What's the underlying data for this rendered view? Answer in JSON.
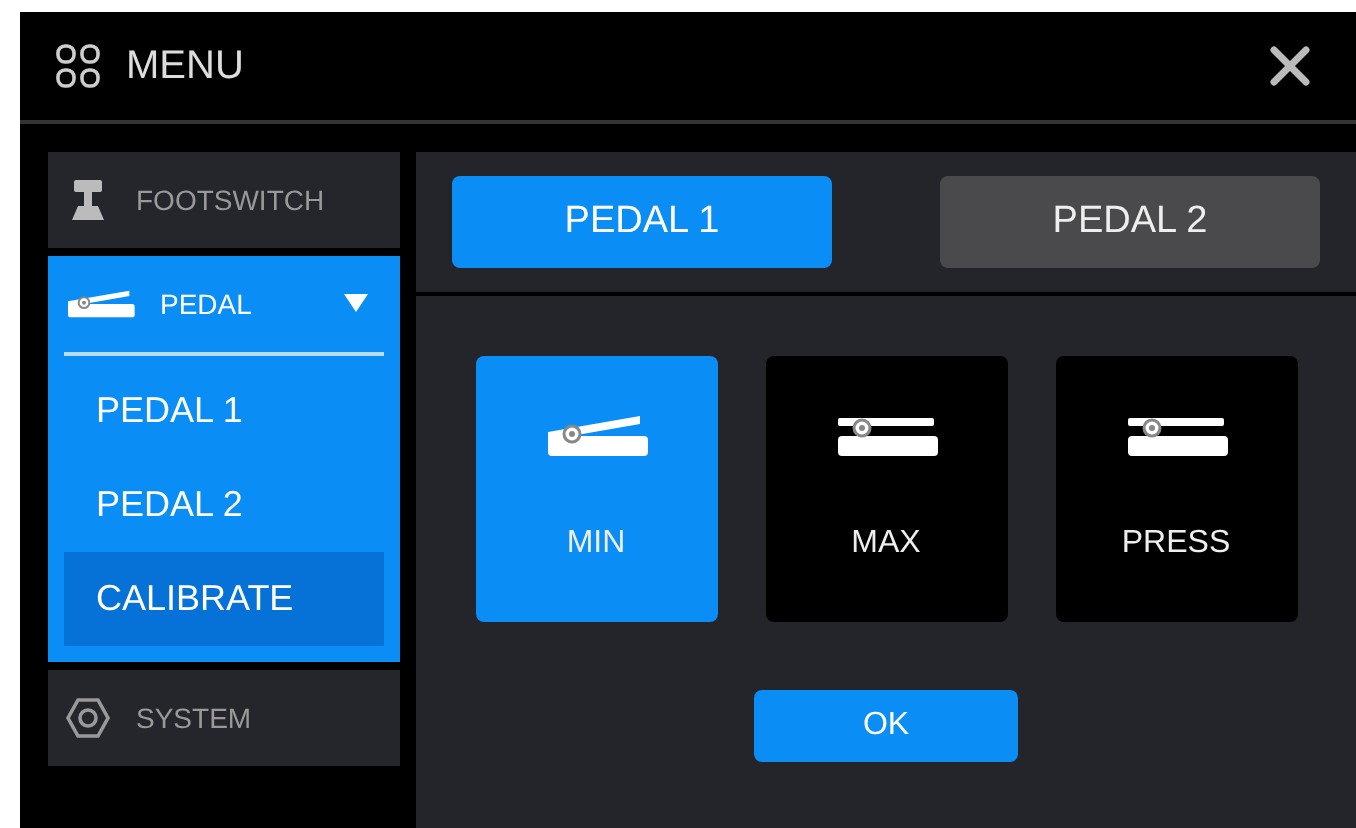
{
  "window": {
    "title": "MENU"
  },
  "sidebar": {
    "items": [
      {
        "label": "FOOTSWITCH",
        "kind": "footswitch",
        "selected": false
      },
      {
        "label": "PEDAL",
        "kind": "pedal",
        "selected": true,
        "expanded": true,
        "children": [
          {
            "label": "PEDAL 1",
            "selected": false
          },
          {
            "label": "PEDAL 2",
            "selected": false
          },
          {
            "label": "CALIBRATE",
            "selected": true
          }
        ]
      },
      {
        "label": "SYSTEM",
        "kind": "system",
        "selected": false
      }
    ]
  },
  "tabs": [
    {
      "label": "PEDAL 1",
      "selected": true
    },
    {
      "label": "PEDAL 2",
      "selected": false
    }
  ],
  "positions": [
    {
      "label": "MIN",
      "kind": "tilted",
      "selected": true
    },
    {
      "label": "MAX",
      "kind": "flat",
      "selected": false
    },
    {
      "label": "PRESS",
      "kind": "flat",
      "selected": false
    }
  ],
  "ok_button": "OK"
}
